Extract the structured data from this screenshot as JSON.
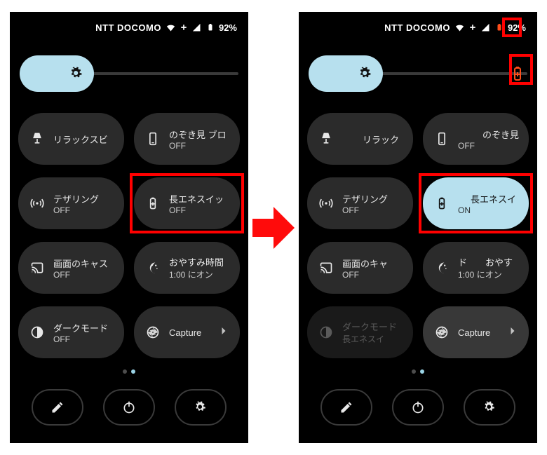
{
  "colors": {
    "accent": "#b7e0ee",
    "highlight": "#ff0000",
    "arrow": "#ff0b0b",
    "battery_saver": "#ff4d1a"
  },
  "status": {
    "carrier": "NTT DOCOMO",
    "battery_pct": "92%"
  },
  "left": {
    "battery_saver_indicator": false,
    "tiles": [
      {
        "icon": "lamp",
        "title": "リラックスビ",
        "sub": ""
      },
      {
        "icon": "phone-screen",
        "title": "のぞき見 ブロ",
        "sub": "OFF"
      },
      {
        "icon": "hotspot",
        "title": "テザリング",
        "sub": "OFF"
      },
      {
        "icon": "battery-plus",
        "title": "長エネスイッ",
        "sub": "OFF",
        "highlight": true
      },
      {
        "icon": "cast",
        "title": "画面のキャス",
        "sub": "OFF"
      },
      {
        "icon": "moon",
        "title": "おやすみ時間",
        "sub": "1:00 にオン"
      },
      {
        "icon": "contrast",
        "title": "ダークモード",
        "sub": "OFF"
      },
      {
        "icon": "aperture",
        "title": "Capture",
        "sub": "",
        "chevron": true
      }
    ]
  },
  "right": {
    "battery_saver_indicator": true,
    "statusbar_batt_highlight": true,
    "tiles": [
      {
        "icon": "lamp",
        "title": "リラック",
        "sub": ""
      },
      {
        "icon": "phone-screen",
        "title": "のぞき見",
        "sub": "OFF",
        "title_prefix_space": true
      },
      {
        "icon": "hotspot",
        "title": "テザリング",
        "sub": "OFF"
      },
      {
        "icon": "battery-plus",
        "title": "長エネスイ",
        "sub": "ON",
        "highlight": true,
        "active": true
      },
      {
        "icon": "cast",
        "title": "画面のキャ",
        "sub": "OFF"
      },
      {
        "icon": "moon",
        "title": "ド　　おやす",
        "sub": "1:00 にオン"
      },
      {
        "icon": "contrast",
        "title": "ダークモード",
        "sub": "長エネスイ",
        "dim": true
      },
      {
        "icon": "aperture",
        "title": "Capture",
        "sub": "",
        "chevron": true,
        "semi": true
      }
    ]
  }
}
